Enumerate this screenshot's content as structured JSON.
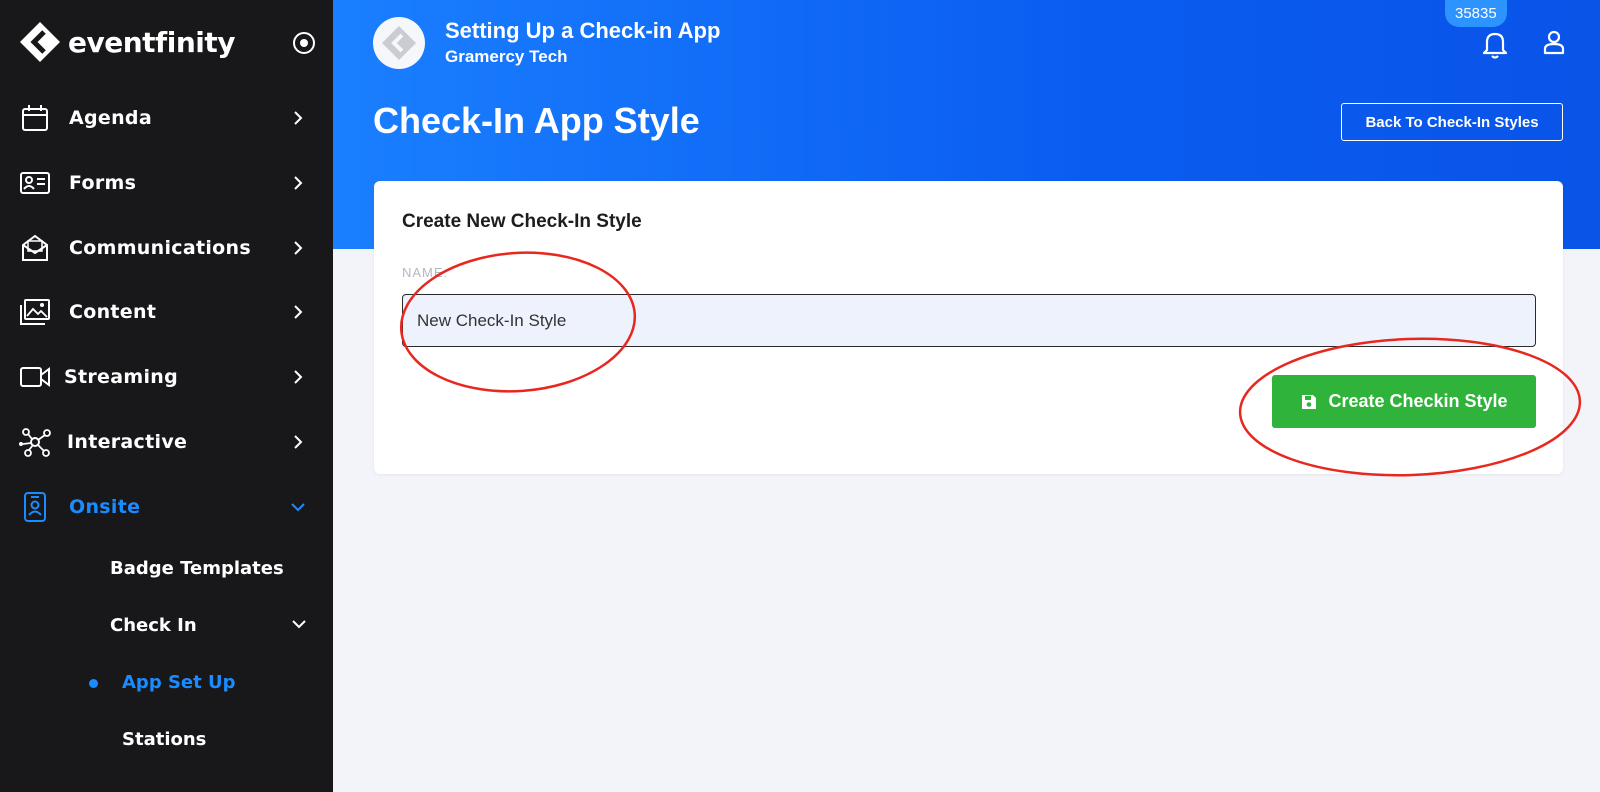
{
  "brand": {
    "name": "eventfinity"
  },
  "sidebar": {
    "items": [
      {
        "label": "Agenda"
      },
      {
        "label": "Forms"
      },
      {
        "label": "Communications"
      },
      {
        "label": "Content"
      },
      {
        "label": "Streaming"
      },
      {
        "label": "Interactive"
      },
      {
        "label": "Onsite"
      }
    ],
    "onsite_sub": {
      "badge_templates": "Badge Templates",
      "check_in": "Check In",
      "app_set_up": "App Set Up",
      "stations": "Stations"
    }
  },
  "header": {
    "event_title": "Setting Up a Check-in App",
    "event_org": "Gramercy Tech",
    "notification_count": "35835",
    "page_title": "Check-In App Style",
    "back_button": "Back To Check-In Styles"
  },
  "form": {
    "card_title": "Create New Check-In Style",
    "name_label": "NAME:",
    "name_value": "New Check-In Style",
    "create_button": "Create Checkin Style"
  },
  "colors": {
    "sidebar_bg": "#18181b",
    "accent": "#1a8cff",
    "header_blue": "#0a5cf0",
    "create_green": "#2fb33b",
    "annotation_red": "#e8271f"
  },
  "icons": [
    "eventfinity-logo-icon",
    "target-icon",
    "calendar-icon",
    "id-card-icon",
    "mail-open-icon",
    "images-icon",
    "video-camera-icon",
    "network-icon",
    "badge-icon",
    "chevron-right-icon",
    "chevron-down-icon",
    "bell-icon",
    "user-icon",
    "save-icon"
  ]
}
